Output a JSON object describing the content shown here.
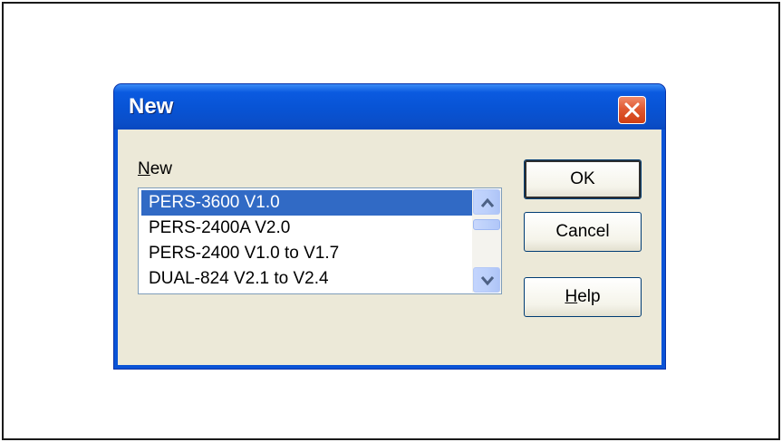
{
  "dialog": {
    "title": "New",
    "close_icon": "close-icon",
    "list_label": "New",
    "list_label_mnemonic": "N",
    "list_label_rest": "ew",
    "items": [
      {
        "label": "PERS-3600 V1.0",
        "selected": true
      },
      {
        "label": "PERS-2400A V2.0",
        "selected": false
      },
      {
        "label": "PERS-2400 V1.0 to V1.7",
        "selected": false
      },
      {
        "label": "DUAL-824 V2.1 to V2.4",
        "selected": false
      }
    ],
    "buttons": {
      "ok": "OK",
      "cancel": "Cancel",
      "help": "Help",
      "help_mnemonic": "H",
      "help_rest": "elp"
    }
  },
  "colors": {
    "title_bar": "#0853d4",
    "selection": "#316ac5",
    "close_button": "#e05a32",
    "dialog_face": "#ece9d8"
  }
}
